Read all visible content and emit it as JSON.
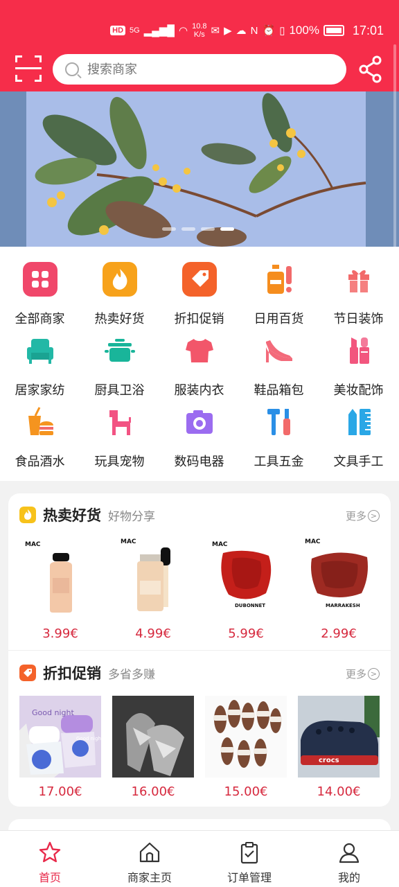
{
  "status_bar": {
    "hd": "HD",
    "network": "5G",
    "speed": "10.8",
    "speed_unit": "K/s",
    "battery": "100%",
    "time": "17:01"
  },
  "header": {
    "search_placeholder": "搜索商家"
  },
  "banner": {
    "slide_count": 4,
    "active_slide": 4
  },
  "categories": [
    {
      "label": "全部商家",
      "icon": "grid-apps-icon",
      "color": "#f0476a"
    },
    {
      "label": "热卖好货",
      "icon": "flame-icon",
      "color": "#f7a21b"
    },
    {
      "label": "折扣促销",
      "icon": "price-tag-icon",
      "color": "#f4622a"
    },
    {
      "label": "日用百货",
      "icon": "toiletries-icon",
      "color": "#f58d1e"
    },
    {
      "label": "节日装饰",
      "icon": "gift-icon",
      "color": "#f26a6a"
    },
    {
      "label": "居家家纺",
      "icon": "armchair-icon",
      "color": "#22b8a6"
    },
    {
      "label": "厨具卫浴",
      "icon": "cooking-pot-icon",
      "color": "#19b59a"
    },
    {
      "label": "服装内衣",
      "icon": "tshirt-icon",
      "color": "#f2566a"
    },
    {
      "label": "鞋品箱包",
      "icon": "high-heel-icon",
      "color": "#f36a7a"
    },
    {
      "label": "美妆配饰",
      "icon": "lipstick-icon",
      "color": "#f2567e"
    },
    {
      "label": "食品酒水",
      "icon": "drink-burger-icon",
      "color": "#f5941f"
    },
    {
      "label": "玩具宠物",
      "icon": "dog-toy-icon",
      "color": "#f25383"
    },
    {
      "label": "数码电器",
      "icon": "camera-icon",
      "color": "#9b6cf0"
    },
    {
      "label": "工具五金",
      "icon": "hammer-screwdriver-icon",
      "color": "#2a8fe6"
    },
    {
      "label": "文具手工",
      "icon": "ruler-pencil-icon",
      "color": "#2aa7e6"
    }
  ],
  "hot_section": {
    "title": "热卖好货",
    "subtitle": "好物分享",
    "more": "更多",
    "products": [
      {
        "brand": "MAC",
        "price": "3.99€"
      },
      {
        "brand": "MAC",
        "price": "4.99€"
      },
      {
        "brand": "MAC",
        "label": "DUBONNET",
        "price": "5.99€"
      },
      {
        "brand": "MAC",
        "label": "MARRAKESH",
        "price": "2.99€"
      }
    ]
  },
  "discount_section": {
    "title": "折扣促销",
    "subtitle": "多省多赚",
    "more": "更多",
    "products": [
      {
        "price": "17.00€",
        "img_text_1": "Good night",
        "img_text_2": "Good night"
      },
      {
        "price": "16.00€"
      },
      {
        "price": "15.00€"
      },
      {
        "price": "14.00€",
        "img_text_1": "crocs"
      }
    ]
  },
  "bottom_nav": [
    {
      "label": "首页",
      "icon": "star-icon",
      "active": true
    },
    {
      "label": "商家主页",
      "icon": "shop-home-icon",
      "active": false
    },
    {
      "label": "订单管理",
      "icon": "clipboard-check-icon",
      "active": false
    },
    {
      "label": "我的",
      "icon": "user-icon",
      "active": false
    }
  ],
  "colors": {
    "brand": "#f62d4a",
    "price": "#d6293e",
    "active_nav": "#e8294a"
  }
}
